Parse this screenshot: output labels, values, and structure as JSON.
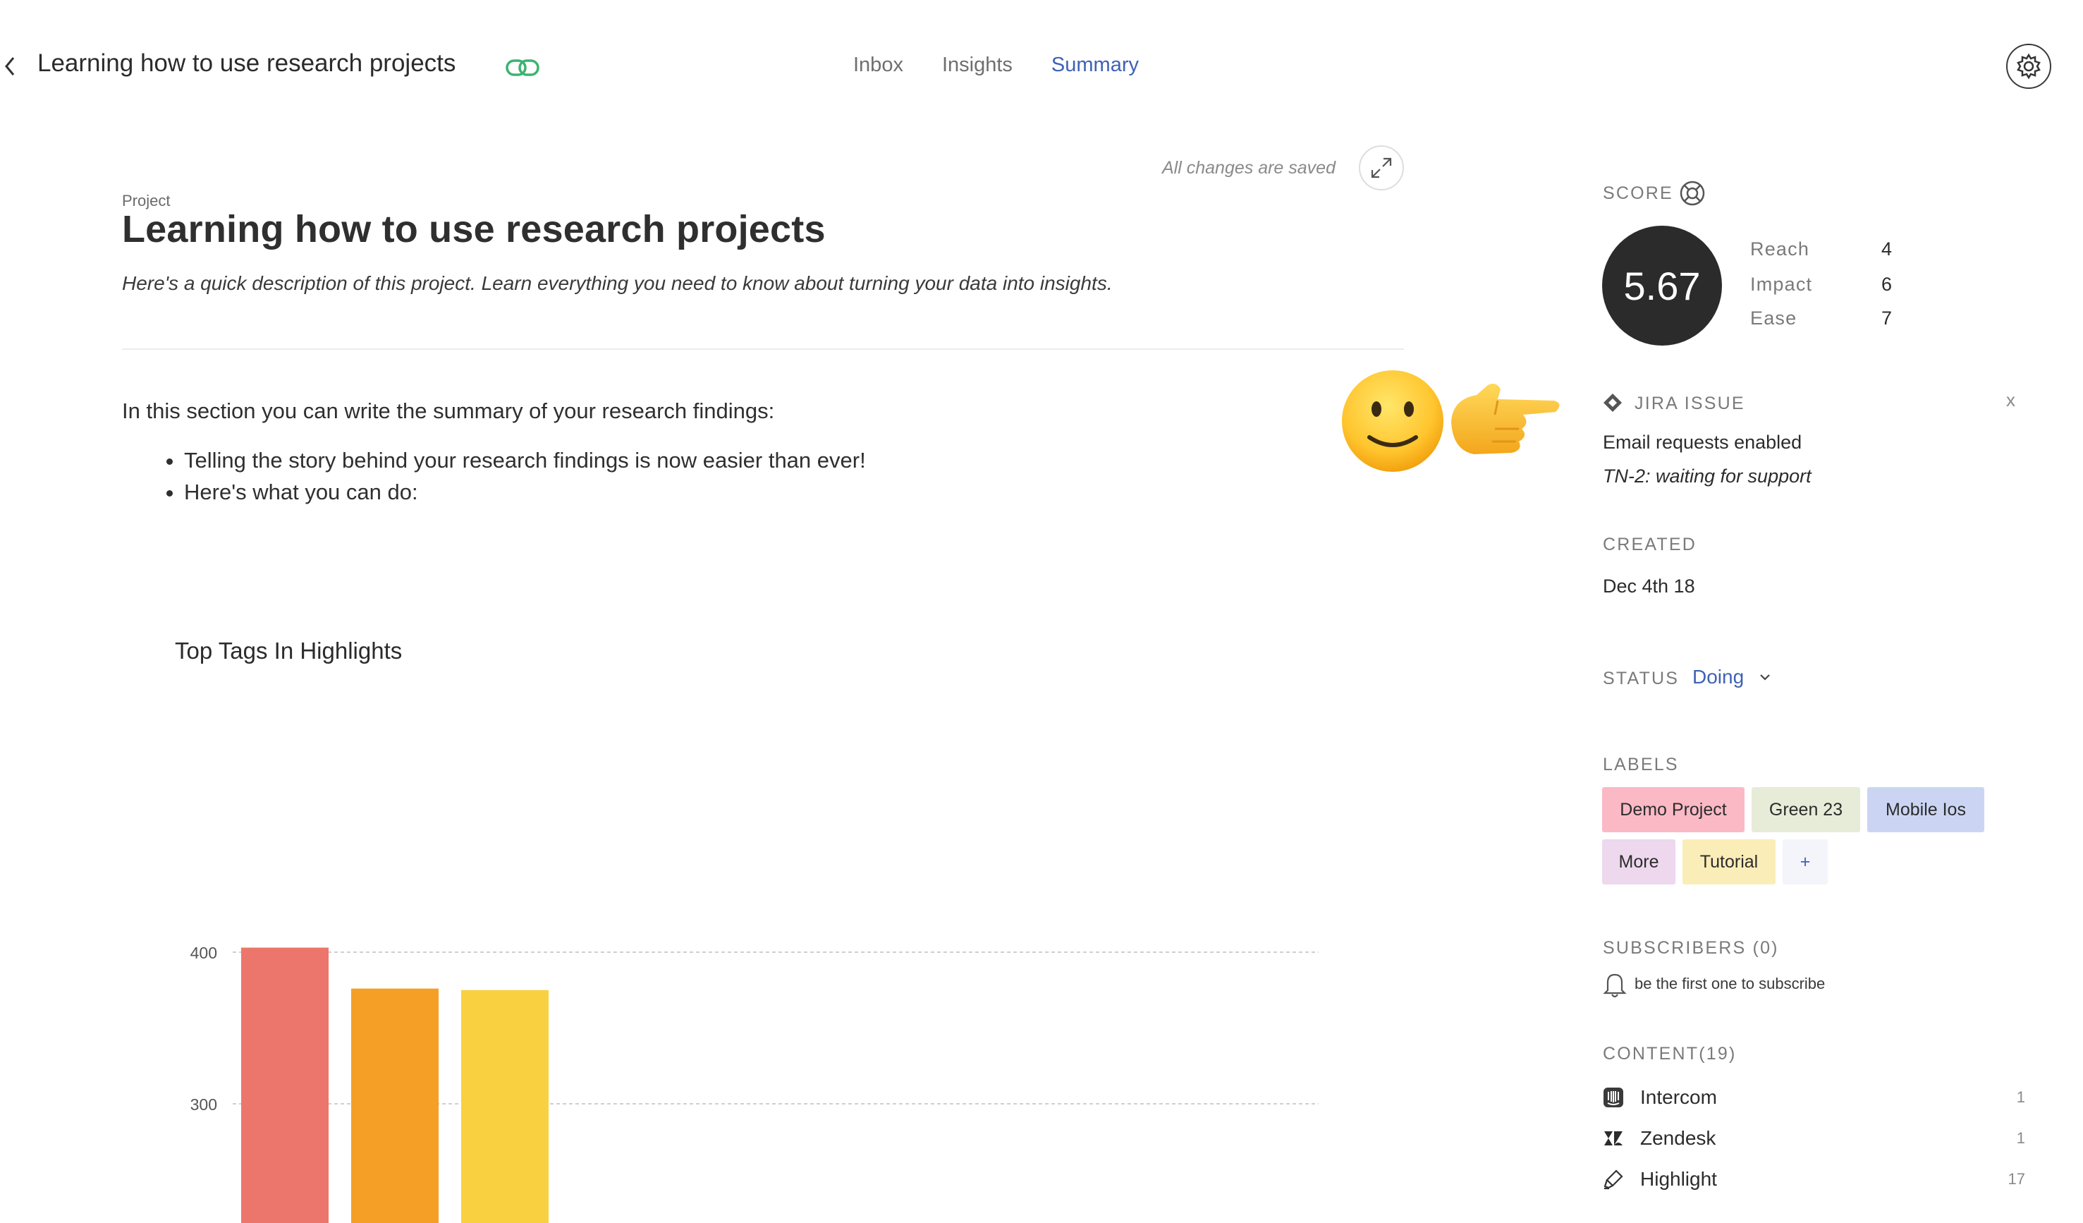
{
  "header": {
    "title": "Learning how to use research projects",
    "tabs": [
      {
        "label": "Inbox",
        "active": false
      },
      {
        "label": "Insights",
        "active": false
      },
      {
        "label": "Summary",
        "active": true
      }
    ]
  },
  "editor": {
    "saved_status": "All changes are saved",
    "project_label": "Project",
    "project_title": "Learning how to use research projects",
    "description": "Here's a quick description of this project. Learn everything you need to know about turning your data into insights.",
    "summary_intro": "In this section you can write the summary of your research findings:",
    "bullets": [
      "Telling the story behind your research findings is now easier than ever!",
      "Here's what you can do:"
    ]
  },
  "chart_data": {
    "type": "bar",
    "title": "Top Tags In Highlights",
    "categories": [
      "",
      "",
      ""
    ],
    "values": [
      403,
      376,
      375
    ],
    "colors": [
      "#ec766b",
      "#f59f27",
      "#f9d03f"
    ],
    "y_ticks": [
      100,
      200,
      300,
      400
    ],
    "ylim": [
      0,
      400
    ],
    "grid": true
  },
  "sidebar": {
    "score": {
      "label": "SCORE",
      "value": "5.67",
      "metrics": [
        {
          "name": "Reach",
          "value": "4"
        },
        {
          "name": "Impact",
          "value": "6"
        },
        {
          "name": "Ease",
          "value": "7"
        }
      ]
    },
    "jira": {
      "label": "JIRA ISSUE",
      "close": "x",
      "summary": "Email requests enabled",
      "status": "TN-2: waiting for support"
    },
    "created": {
      "label": "CREATED",
      "date": "Dec 4th 18"
    },
    "status": {
      "label": "STATUS",
      "value": "Doing"
    },
    "labels": {
      "label": "LABELS",
      "chips": [
        {
          "text": "Demo Project",
          "color": "#fbb9c5"
        },
        {
          "text": "Green 23",
          "color": "#e6ecd8"
        },
        {
          "text": "Mobile Ios",
          "color": "#cbd5f3"
        },
        {
          "text": "More",
          "color": "#edd8ee"
        },
        {
          "text": "Tutorial",
          "color": "#fbedb7"
        }
      ],
      "add_label": "+"
    },
    "subscribers": {
      "label": "SUBSCRIBERS (0)",
      "hint": "be the first one to subscribe"
    },
    "content": {
      "label": "CONTENT(19)",
      "items": [
        {
          "name": "Intercom",
          "count": "1",
          "icon": "intercom-icon"
        },
        {
          "name": "Zendesk",
          "count": "1",
          "icon": "zendesk-icon"
        },
        {
          "name": "Highlight",
          "count": "17",
          "icon": "highlighter-icon"
        }
      ]
    }
  }
}
